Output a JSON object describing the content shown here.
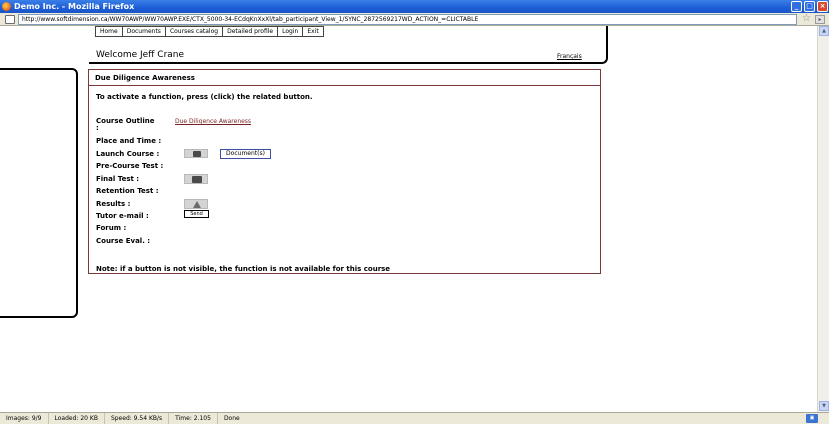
{
  "window": {
    "title": "Demo Inc. - Mozilla Firefox",
    "minimize": "_",
    "maximize": "□",
    "close": "×"
  },
  "address": {
    "url": "http://www.softdimension.ca/WW70AWP/WW70AWP.EXE/CTX_5000-34-ECdqKnXxXl/tab_participant_View_1/SYNC_2872569217WD_ACTION_=CLICTABLE"
  },
  "nav": {
    "items": [
      "Home",
      "Documents",
      "Courses catalog",
      "Detailed profile",
      "Login",
      "Exit"
    ]
  },
  "header": {
    "welcome": "Welcome Jeff Crane",
    "language": "Français"
  },
  "course": {
    "title": "Due Diligence Awareness",
    "instructions": "To activate a function, press (click) the related button.",
    "outline_label": "Course Outline",
    "outline_colon": ":",
    "outline_link": "Due Diligence Awareness",
    "place_time_label": "Place and Time :",
    "launch_label": "Launch Course :",
    "documents_button": "Document(s)",
    "pre_test_label": "Pre-Course Test :",
    "final_test_label": "Final Test :",
    "retention_label": "Retention Test :",
    "results_label": "Results :",
    "tutor_label": "Tutor e-mail :",
    "email_button": "Send",
    "forum_label": "Forum :",
    "eval_label": "Course Eval. :",
    "note": "Note: if a button is not visible, the function is not available for this course"
  },
  "status": {
    "images": "Images: 9/9",
    "loaded": "Loaded: 20 KB",
    "speed": "Speed: 9.54 KB/s",
    "time": "Time: 2.105",
    "done": "Done"
  }
}
